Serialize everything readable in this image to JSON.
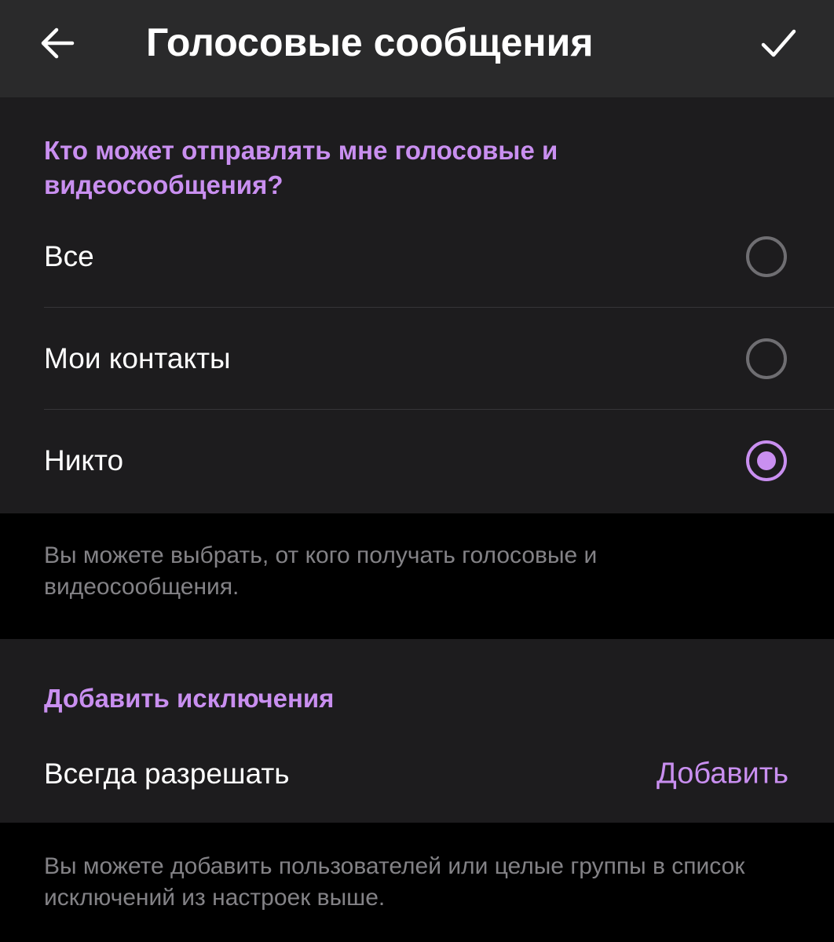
{
  "header": {
    "title": "Голосовые сообщения",
    "back_icon": "arrow-left-icon",
    "confirm_icon": "check-icon"
  },
  "privacy_section": {
    "title": "Кто может отправлять мне голосовые и видеосообщения?",
    "options": [
      {
        "label": "Все",
        "selected": false
      },
      {
        "label": "Мои контакты",
        "selected": false
      },
      {
        "label": "Никто",
        "selected": true
      }
    ],
    "info": "Вы можете выбрать, от кого получать голосовые и видеосообщения."
  },
  "exceptions_section": {
    "title": "Добавить исключения",
    "always_allow_label": "Всегда разрешать",
    "add_label": "Добавить",
    "info": "Вы можете добавить пользователей или целые группы в список исключений из настроек выше."
  },
  "colors": {
    "accent": "#c98ff0",
    "header_bg": "#2a2a2b",
    "section_bg": "#1d1c1e",
    "page_bg": "#000000",
    "muted_text": "#838286"
  }
}
